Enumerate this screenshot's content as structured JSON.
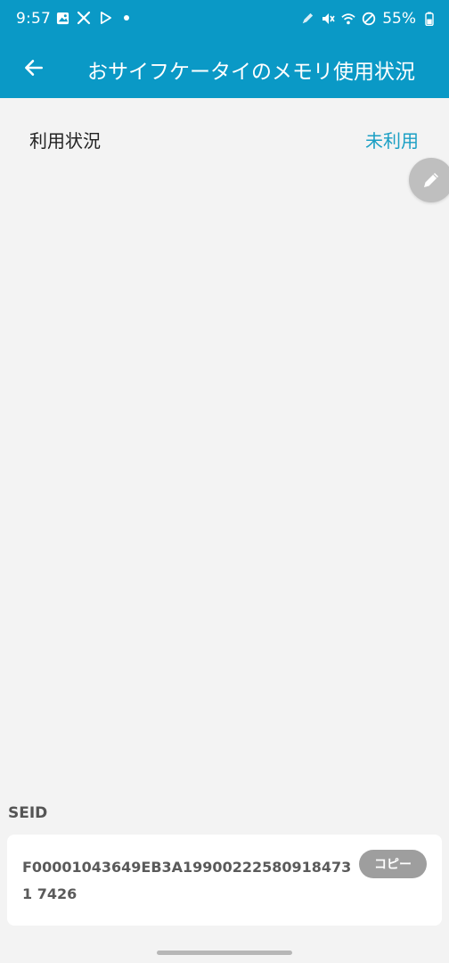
{
  "status_bar": {
    "time": "9:57",
    "battery": "55%",
    "left_icons": [
      "image-icon",
      "tools-icon",
      "play-store-icon",
      "dot-icon"
    ],
    "right_icons": [
      "pen-icon",
      "mute-icon",
      "wifi-icon",
      "dnd-icon",
      "battery-icon"
    ]
  },
  "app_bar": {
    "title": "おサイフケータイのメモリ使用状況",
    "back_icon": "arrow-left-icon"
  },
  "usage": {
    "label": "利用状況",
    "value": "未利用"
  },
  "fab": {
    "icon": "pencil-icon"
  },
  "seid": {
    "label": "SEID",
    "value": "F00001043649EB3A199002225809184731 7426",
    "copy_label": "コピー"
  },
  "colors": {
    "primary": "#0a99c6",
    "accent_text": "#1a9fc4",
    "background": "#f3f3f3",
    "copy_button": "#9e9e9e",
    "fab": "#bfbfbf"
  }
}
